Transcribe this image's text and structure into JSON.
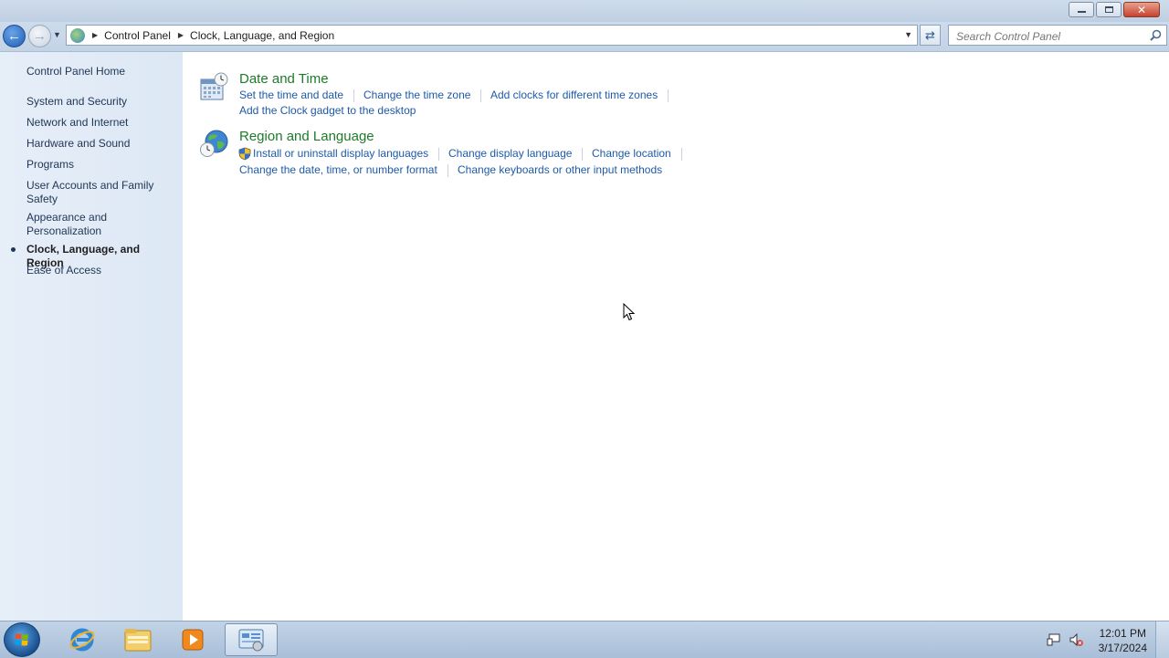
{
  "window": {
    "caption": {
      "minimize": "",
      "restore": "",
      "close": "✕"
    }
  },
  "nav": {
    "breadcrumbs": [
      "Control Panel",
      "Clock, Language, and Region"
    ],
    "search_placeholder": "Search Control Panel"
  },
  "sidebar": {
    "home": "Control Panel Home",
    "items": [
      {
        "label": "System and Security",
        "active": false
      },
      {
        "label": "Network and Internet",
        "active": false
      },
      {
        "label": "Hardware and Sound",
        "active": false
      },
      {
        "label": "Programs",
        "active": false
      },
      {
        "label": "User Accounts and Family Safety",
        "active": false
      },
      {
        "label": "Appearance and Personalization",
        "active": false
      },
      {
        "label": "Clock, Language, and Region",
        "active": true
      },
      {
        "label": "Ease of Access",
        "active": false
      }
    ]
  },
  "main": {
    "categories": [
      {
        "title": "Date and Time",
        "icon": "calendar-clock-icon",
        "tasks": [
          "Set the time and date",
          "Change the time zone",
          "Add clocks for different time zones",
          "Add the Clock gadget to the desktop"
        ]
      },
      {
        "title": "Region and Language",
        "icon": "globe-clock-icon",
        "tasks": [
          "Install or uninstall display languages",
          "Change display language",
          "Change location",
          "Change the date, time, or number format",
          "Change keyboards or other input methods"
        ]
      }
    ]
  },
  "taskbar": {
    "pinned": [
      "internet-explorer-icon",
      "windows-explorer-icon",
      "media-player-icon",
      "control-panel-icon"
    ],
    "clock": {
      "time": "12:01 PM",
      "date": "3/17/2024"
    }
  },
  "colors": {
    "category_title": "#1e7a2a",
    "link": "#1e5aa8",
    "sidebar_bg": "#e6eef8"
  }
}
